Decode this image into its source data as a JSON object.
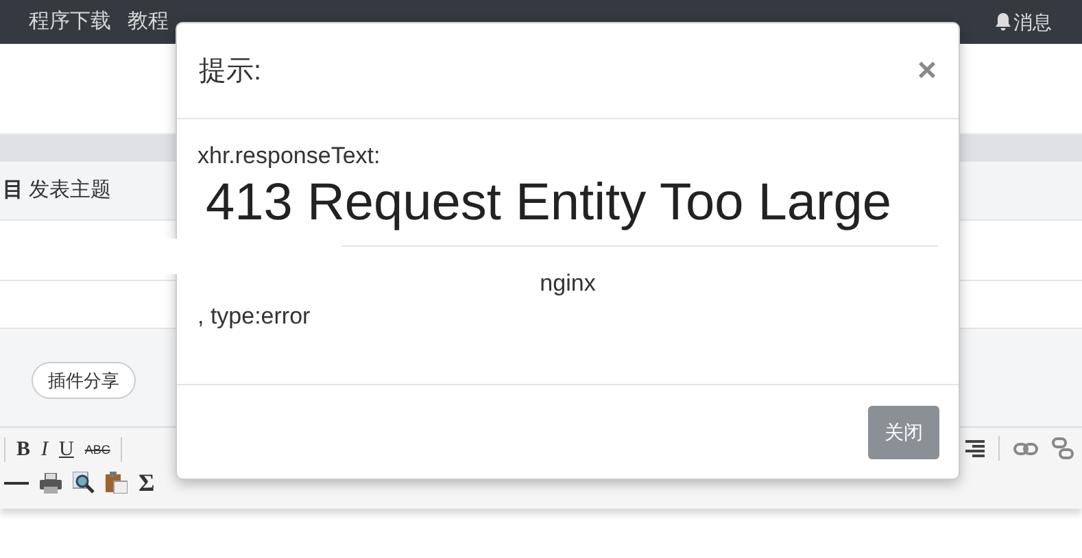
{
  "navbar": {
    "links": [
      "程序下载",
      "教程"
    ],
    "notifications": "消息"
  },
  "breadcrumb": {
    "current": "目",
    "action": "发表主题"
  },
  "tags": [
    "插件分享"
  ],
  "editor_toolbar": {
    "format_buttons": [
      "B",
      "I",
      "U",
      "ABC"
    ],
    "sum_button": "Σ"
  },
  "modal": {
    "title": "提示:",
    "close": "×",
    "label": "xhr.responseText:",
    "heading": "413 Request Entity Too Large",
    "server": "nginx",
    "type_line": ", type:error",
    "button": "关闭"
  }
}
